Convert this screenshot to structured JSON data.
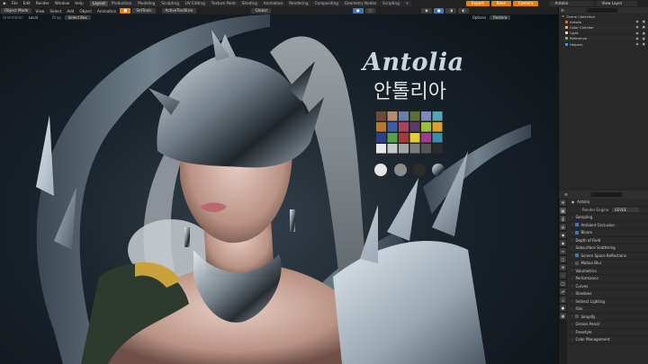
{
  "topbar": {
    "menus": [
      "File",
      "Edit",
      "Render",
      "Window",
      "Help"
    ],
    "workspaces": [
      "Layout",
      "Production",
      "Modeling",
      "Sculpting",
      "UV Editing",
      "Texture Paint",
      "Shading",
      "Animation",
      "Rendering",
      "Compositing",
      "Geometry Nodes",
      "Scripting"
    ],
    "active_workspace": "Layout",
    "right_buttons": [
      "Export",
      "Bake",
      "Camera"
    ],
    "scene_name": "Antolia",
    "view_layer": "View Layer"
  },
  "viewport": {
    "header": [
      "Object Mode",
      "View",
      "Select",
      "Add",
      "Object",
      "Animation"
    ],
    "shading_tab": "SetTools",
    "active_tool": "ActiveToolSlice",
    "transform": "Global",
    "orientation_label": "Orientation",
    "local_label": "Local",
    "drag_label": "Drag",
    "select_box": "Select Box",
    "options": "Options",
    "restore": "Restore"
  },
  "scene": {
    "logo_text": "Antolia",
    "korean_text": "안톨리아",
    "palette": [
      "#6e4a3a",
      "#b88a6e",
      "#6a7fa8",
      "#5d6d3c",
      "#7f88b9",
      "#56a5b2",
      "#b6792e",
      "#3d5ea6",
      "#a8455c",
      "#5a3a6a",
      "#9bbf3a",
      "#d9a031",
      "#2e3d8c",
      "#5aa04a",
      "#a53a3a",
      "#e2cc3a",
      "#a53a8c",
      "#3a8ea5",
      "#e8e8e8",
      "#c8c8c8",
      "#a3a3a3",
      "#7a7a7a",
      "#545454",
      "#2c2c2c"
    ]
  },
  "outliner": {
    "title": "Scene Collection",
    "items": [
      {
        "name": "Antolia",
        "color": "#e06a3a"
      },
      {
        "name": "Color Checker",
        "color": "#e0c23a"
      },
      {
        "name": "Light",
        "color": "#d6d6d6"
      },
      {
        "name": "Reference",
        "color": "#6cc04a"
      },
      {
        "name": "Helpers",
        "color": "#3a9ae0"
      }
    ]
  },
  "properties": {
    "scene_label": "Antolia",
    "render_engine_label": "Render Engine",
    "render_engine": "EEVEE",
    "panels": [
      {
        "label": "Sampling",
        "type": "section"
      },
      {
        "label": "Ambient Occlusion",
        "type": "check",
        "on": true
      },
      {
        "label": "Bloom",
        "type": "check",
        "on": true
      },
      {
        "label": "Depth of Field",
        "type": "section"
      },
      {
        "label": "Subsurface Scattering",
        "type": "section"
      },
      {
        "label": "Screen Space Reflections",
        "type": "check",
        "on": true
      },
      {
        "label": "Motion Blur",
        "type": "check",
        "on": false
      },
      {
        "label": "Volumetrics",
        "type": "section"
      },
      {
        "label": "Performance",
        "type": "section"
      },
      {
        "label": "Curves",
        "type": "section"
      },
      {
        "label": "Shadows",
        "type": "section"
      },
      {
        "label": "Indirect Lighting",
        "type": "section"
      },
      {
        "label": "Film",
        "type": "section"
      },
      {
        "label": "Simplify",
        "type": "check",
        "on": false
      },
      {
        "label": "Grease Pencil",
        "type": "section"
      },
      {
        "label": "Freestyle",
        "type": "section"
      },
      {
        "label": "Color Management",
        "type": "section"
      }
    ]
  }
}
